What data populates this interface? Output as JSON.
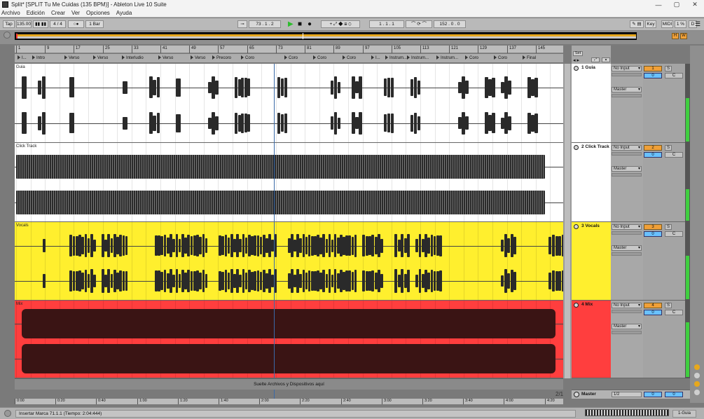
{
  "window": {
    "title": "Split* [SPLIT Tu Me Cuidas (135 BPM)] - Ableton Live 10 Suite",
    "minimize": "—",
    "maximize": "▢",
    "close": "✕"
  },
  "menu": [
    "Archivo",
    "Edición",
    "Crear",
    "Ver",
    "Opciones",
    "Ayuda"
  ],
  "control_bar": {
    "tap": "Tap",
    "tempo": "135.00",
    "time_sig": "4 / 4",
    "loop_mode": "○●",
    "quantize": "1 Bar",
    "arrangement_pos": "73 .  1 .  2",
    "loop_start": "1 .  1 .  1",
    "loop_length": "152 .  0 .  0",
    "key": "Key",
    "midi": "MIDI",
    "cpu": "1 %",
    "d": "D"
  },
  "ruler": {
    "bars": [
      "1",
      "9",
      "17",
      "25",
      "33",
      "41",
      "49",
      "57",
      "65",
      "73",
      "81",
      "89",
      "97",
      "105",
      "113",
      "121",
      "129",
      "137",
      "145"
    ]
  },
  "locators": [
    {
      "label": "I..."
    },
    {
      "label": "Intro"
    },
    {
      "label": "Verso"
    },
    {
      "label": "Verso"
    },
    {
      "label": "Interludio"
    },
    {
      "label": "Verso"
    },
    {
      "label": "Verso"
    },
    {
      "label": "Precoro"
    },
    {
      "label": "Coro"
    },
    {
      "label": "Coro"
    },
    {
      "label": "Coro"
    },
    {
      "label": "Coro"
    },
    {
      "label": "I..."
    },
    {
      "label": "Instrum..."
    },
    {
      "label": "Instrum..."
    },
    {
      "label": "Instrum..."
    },
    {
      "label": "Coro"
    },
    {
      "label": "Coro"
    },
    {
      "label": "Final"
    }
  ],
  "set_label": "Set",
  "tracks": [
    {
      "clip_name": "Guia",
      "track_name": "1 Guia",
      "number": "1",
      "input": "No Input",
      "output": "Master",
      "solo": "S",
      "pan": "0",
      "crossfade": "C",
      "color": "#ffffff",
      "meter": 0.55
    },
    {
      "clip_name": "Click Track",
      "track_name": "2 Click Track",
      "number": "2",
      "input": "No Input",
      "output": "Master",
      "solo": "S",
      "pan": "0",
      "crossfade": "C",
      "color": "#ffffff",
      "meter": 0.4
    },
    {
      "clip_name": "Vocals",
      "track_name": "3 Vocals",
      "number": "3",
      "input": "No Input",
      "output": "Master",
      "solo": "S",
      "pan": "0",
      "crossfade": "C",
      "color": "#ffef2e",
      "meter": 0.55
    },
    {
      "clip_name": "Mix",
      "track_name": "4 Mix",
      "number": "4",
      "input": "No Input",
      "output": "Master",
      "solo": "S",
      "pan": "0",
      "crossfade": "C",
      "color": "#ff3e3e",
      "meter": 0.7
    }
  ],
  "drop_zone": "Suelte Archivos y Dispositivos aquí",
  "zoom_fraction": "2/1",
  "master": {
    "name": "Master",
    "output": "1/2",
    "volume": "0",
    "pan": "0"
  },
  "time_ruler": [
    "0:00",
    "0:20",
    "0:40",
    "1:00",
    "1:20",
    "1:40",
    "2:00",
    "2:20",
    "2:40",
    "3:00",
    "3:20",
    "3:40",
    "4:00",
    "4:20"
  ],
  "status": {
    "message": "Insertar Marca 71.1.1 (Tiempo: 2:04:444)",
    "track": "1-Guia"
  },
  "colors": {
    "accent": "#f0a038",
    "play": "#2cbd2c",
    "ovline": "#e8a81c"
  }
}
